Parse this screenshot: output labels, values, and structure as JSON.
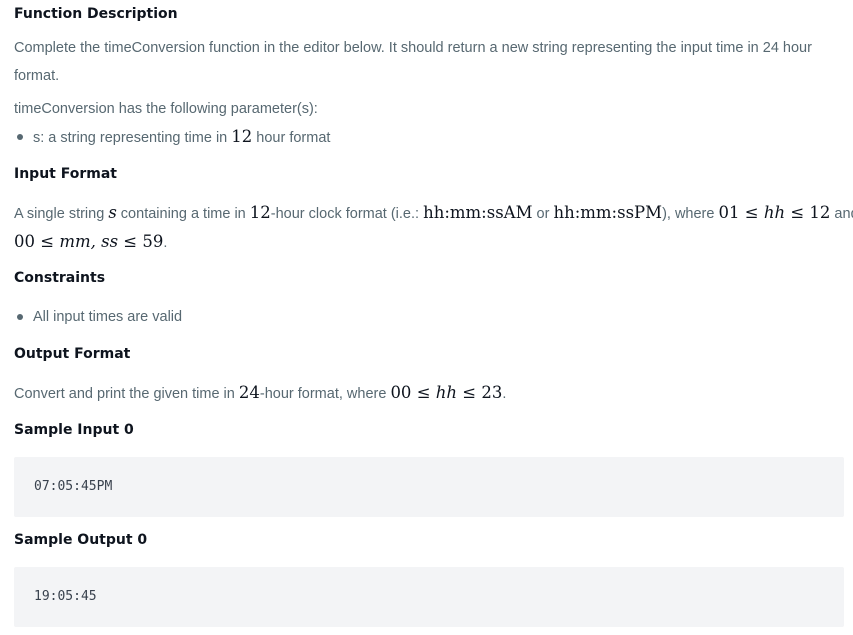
{
  "function_description": {
    "heading": "Function Description",
    "intro_line1": "Complete the timeConversion function in the editor below. It should return a new string representing the input time in 24 hour",
    "intro_line2": "format.",
    "params_intro": "timeConversion has the following parameter(s):",
    "param_prefix": "s: a string representing time in ",
    "param_number": "12",
    "param_suffix": " hour format"
  },
  "input_format": {
    "heading": "Input Format",
    "p1": "A single string ",
    "var_s": "s",
    "p2": " containing a time in ",
    "num_12": "12",
    "p3": "-hour clock format (i.e.: ",
    "fmt_am": "hh:mm:ssAM",
    "p4": " or ",
    "fmt_pm": "hh:mm:ssPM",
    "p5": "), where ",
    "range1_lo": "01",
    "leq": "≤",
    "var_hh": "hh",
    "range1_hi": "12",
    "p6": " and",
    "range2_lo": "00",
    "var_mm_ss": "mm, ss",
    "range2_hi": "59",
    "period": "."
  },
  "constraints": {
    "heading": "Constraints",
    "items": [
      "All input times are valid"
    ]
  },
  "output_format": {
    "heading": "Output Format",
    "p1": "Convert and print the given time in ",
    "num_24": "24",
    "p2": "-hour format, where ",
    "range_lo": "00",
    "var_hh": "hh",
    "range_hi": "23",
    "period": "."
  },
  "sample_input": {
    "heading": "Sample Input 0",
    "code": "07:05:45PM"
  },
  "sample_output": {
    "heading": "Sample Output 0",
    "code": "19:05:45"
  },
  "colors": {
    "heading_text": "#0e141e",
    "body_text": "#576871",
    "code_background": "#f3f4f6"
  }
}
